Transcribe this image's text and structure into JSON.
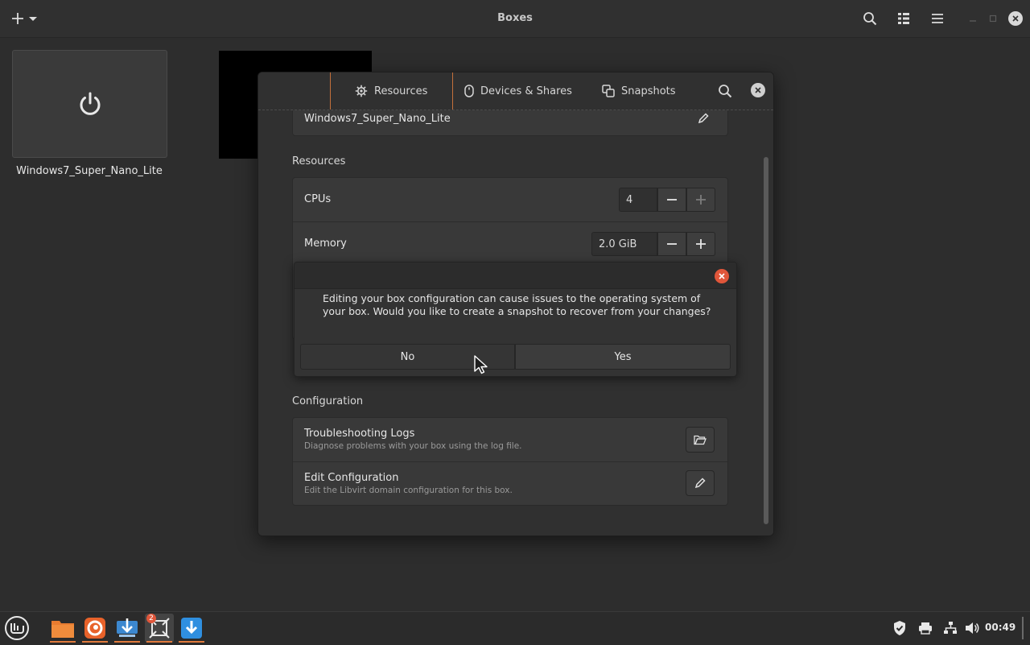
{
  "window": {
    "title": "Boxes"
  },
  "boxes": [
    {
      "name": "Windows7_Super_Nano_Lite"
    }
  ],
  "properties": {
    "tabs": [
      {
        "label": "Resources",
        "icon": "gear-icon"
      },
      {
        "label": "Devices & Shares",
        "icon": "mouse-icon"
      },
      {
        "label": "Snapshots",
        "icon": "snapshots-icon"
      }
    ],
    "name_field": {
      "value": "Windows7_Super_Nano_Lite"
    },
    "resources": {
      "title": "Resources",
      "cpus": {
        "label": "CPUs",
        "value": "4"
      },
      "memory": {
        "label": "Memory",
        "value": "2.0 GiB"
      }
    },
    "configuration": {
      "title": "Configuration",
      "troubleshooting": {
        "title": "Troubleshooting Logs",
        "subtitle": "Diagnose problems with your box using the log file."
      },
      "edit_config": {
        "title": "Edit Configuration",
        "subtitle": "Edit the Libvirt domain configuration for this box."
      }
    }
  },
  "snapshot_prompt": {
    "message": "Editing your box configuration can cause issues to the operating system of your box. Would you like to create a snapshot to recover from your changes?",
    "no_label": "No",
    "yes_label": "Yes"
  },
  "taskbar": {
    "apps": [
      "menu-icon",
      "files-icon",
      "firefox-icon",
      "installer-icon",
      "boxes-icon",
      "update-icon"
    ],
    "boxes_badge": "2",
    "clock": "00:49"
  },
  "colors": {
    "accent": "#e07a3c",
    "close": "#e0563a"
  }
}
